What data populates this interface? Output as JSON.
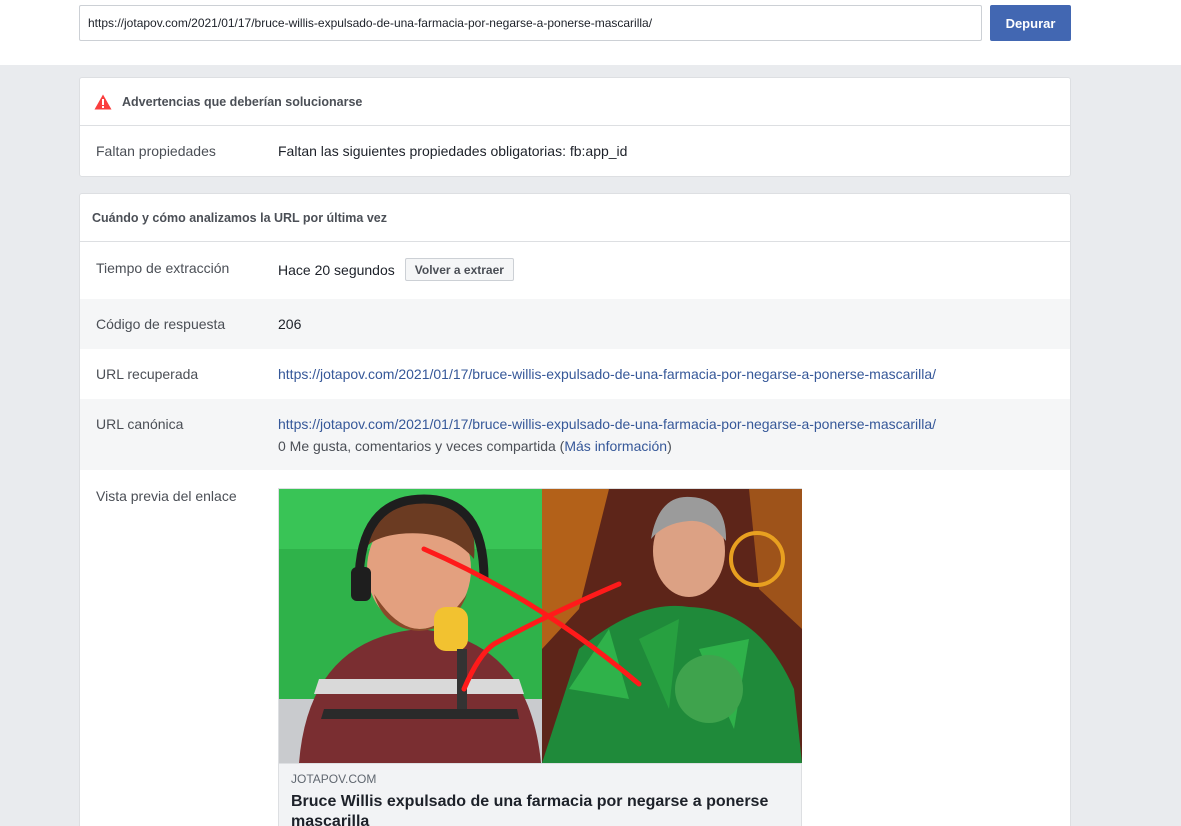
{
  "toolbar": {
    "url_value": "https://jotapov.com/2021/01/17/bruce-willis-expulsado-de-una-farmacia-por-negarse-a-ponerse-mascarilla/",
    "debug_label": "Depurar"
  },
  "warnings": {
    "title": "Advertencias que deberían solucionarse",
    "rows": [
      {
        "label": "Faltan propiedades",
        "value": "Faltan las siguientes propiedades obligatorias: fb:app_id"
      }
    ]
  },
  "scrape": {
    "title": "Cuándo y cómo analizamos la URL por última vez",
    "time_label": "Tiempo de extracción",
    "time_value": "Hace 20 segundos",
    "rescrape_label": "Volver a extraer",
    "code_label": "Código de respuesta",
    "code_value": "206",
    "fetched_label": "URL recuperada",
    "fetched_value": "https://jotapov.com/2021/01/17/bruce-willis-expulsado-de-una-farmacia-por-negarse-a-ponerse-mascarilla/",
    "canonical_label": "URL canónica",
    "canonical_value": "https://jotapov.com/2021/01/17/bruce-willis-expulsado-de-una-farmacia-por-negarse-a-ponerse-mascarilla/",
    "engagement_text": "0 Me gusta, comentarios y veces compartida",
    "more_info_label": "Más información",
    "preview_label": "Vista previa del enlace",
    "preview_domain": "JOTAPOV.COM",
    "preview_title": "Bruce Willis expulsado de una farmacia por negarse a ponerse mascarilla"
  },
  "colors": {
    "accent": "#4267b2",
    "link": "#365899",
    "warning": "#fa3e3e",
    "page_bg": "#e9ebee"
  },
  "icons": {
    "warning": "warning-triangle-icon",
    "microphone": "microphone-icon",
    "headphones": "headphones-icon"
  }
}
